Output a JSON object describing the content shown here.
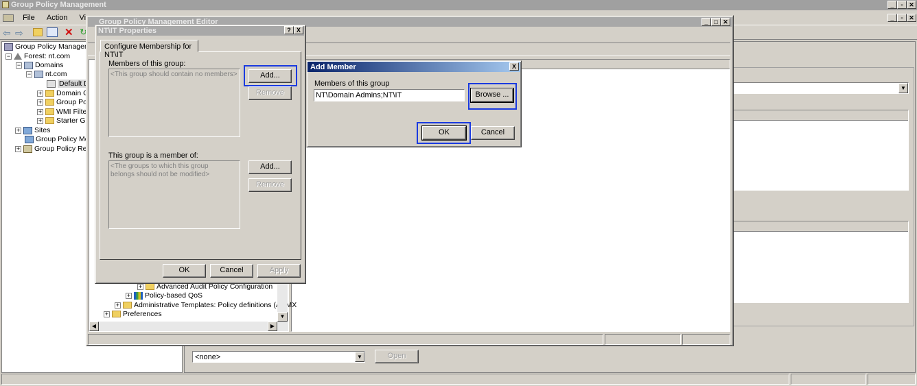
{
  "main_window": {
    "title": "Group Policy Management",
    "menu": [
      "File",
      "Action",
      "View"
    ],
    "tree": [
      {
        "label": "Group Policy Management",
        "level": 0
      },
      {
        "label": "Forest: nt.com",
        "level": 1
      },
      {
        "label": "Domains",
        "level": 2
      },
      {
        "label": "nt.com",
        "level": 3
      },
      {
        "label": "Default D",
        "level": 4
      },
      {
        "label": "Domain C",
        "level": 4
      },
      {
        "label": "Group Pol",
        "level": 4
      },
      {
        "label": "WMI Filte",
        "level": 4
      },
      {
        "label": "Starter Gl",
        "level": 4
      },
      {
        "label": "Sites",
        "level": 1
      },
      {
        "label": "Group Policy Mode",
        "level": 1
      },
      {
        "label": "Group Policy Resu",
        "level": 1
      }
    ],
    "wmi_dropdown_value": "<none>",
    "open_button": "Open"
  },
  "editor_window": {
    "title": "Group Policy Management Editor",
    "tree_bottom": [
      {
        "label": "Advanced Audit Policy Configuration"
      },
      {
        "label": "Policy-based QoS"
      },
      {
        "label": "Administrative Templates: Policy definitions (ADMX"
      },
      {
        "label": "Preferences"
      }
    ]
  },
  "properties_dialog": {
    "title": "NT\\IT Properties",
    "tab": "Configure Membership for NT\\IT",
    "members_label": "Members of this group:",
    "members_placeholder": "<This group should contain no members>",
    "member_of_label": "This group is a member of:",
    "member_of_placeholder": "<The groups to which this group belongs should not be modified>",
    "add_button": "Add...",
    "remove_button": "Remove",
    "ok_button": "OK",
    "cancel_button": "Cancel",
    "apply_button": "Apply",
    "help_caption": "?",
    "close_caption": "X"
  },
  "add_member_dialog": {
    "title": "Add Member",
    "members_label": "Members of this group",
    "members_value": "NT\\Domain Admins;NT\\IT",
    "browse_button": "Browse ...",
    "ok_button": "OK",
    "cancel_button": "Cancel",
    "close_caption": "X"
  },
  "colors": {
    "highlight": "#1a3ae0",
    "dialog_bg": "#d4d0c8",
    "active_title": "#0a246a"
  }
}
